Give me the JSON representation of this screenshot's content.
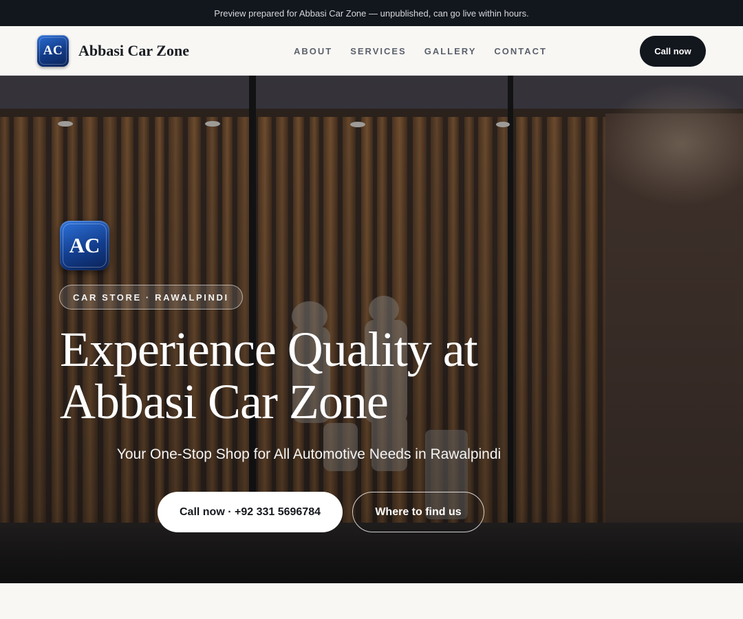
{
  "announcement": "Preview prepared for Abbasi Car Zone — unpublished, can go live within hours.",
  "brand": {
    "logo_text": "AC",
    "name": "Abbasi Car Zone"
  },
  "nav": [
    {
      "label": "ABOUT"
    },
    {
      "label": "SERVICES"
    },
    {
      "label": "GALLERY"
    },
    {
      "label": "CONTACT"
    }
  ],
  "header_cta": "Call now",
  "hero": {
    "logo_text": "AC",
    "eyebrow": "CAR STORE · RAWALPINDI",
    "headline_line1": "Experience Quality at",
    "headline_line2": "Abbasi Car Zone",
    "subtitle": "Your One-Stop Shop for All Automotive Needs in Rawalpindi",
    "primary_cta": "Call now · +92 331 5696784",
    "secondary_cta": "Where to find us"
  },
  "colors": {
    "dark": "#12161d",
    "logo_blue": "#133e8e",
    "background": "#f8f7f4"
  }
}
